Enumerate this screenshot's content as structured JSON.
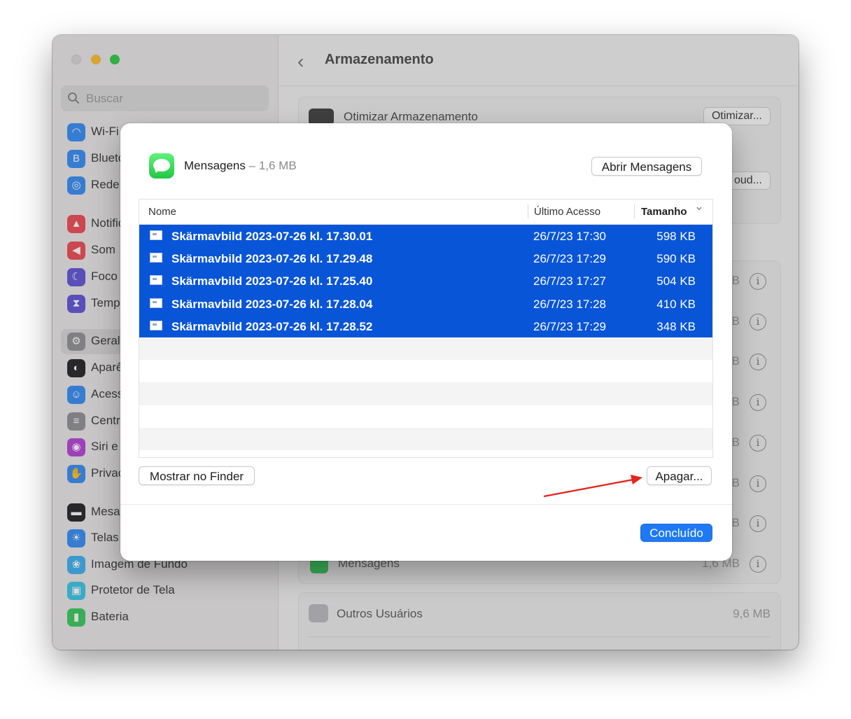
{
  "sidebar": {
    "search_placeholder": "Buscar",
    "items": [
      {
        "label": "Wi-Fi",
        "icon": "wifi-icon",
        "color": "#2f8af6"
      },
      {
        "label": "Bluetooth",
        "icon": "bluetooth-icon",
        "color": "#2f8af6"
      },
      {
        "label": "Rede",
        "icon": "globe-icon",
        "color": "#2f8af6"
      },
      {
        "label": "Notificações",
        "icon": "bell-icon",
        "color": "#f0454d"
      },
      {
        "label": "Som",
        "icon": "speaker-icon",
        "color": "#f0454d"
      },
      {
        "label": "Foco",
        "icon": "moon-icon",
        "color": "#5a4fd6"
      },
      {
        "label": "Tempo de Uso",
        "icon": "hourglass-icon",
        "color": "#5a4fd6"
      },
      {
        "label": "Geral",
        "icon": "gear-icon",
        "color": "#8e8e93"
      },
      {
        "label": "Aparência",
        "icon": "appearance-icon",
        "color": "#1d1d1f"
      },
      {
        "label": "Acessibilidade",
        "icon": "accessibility-icon",
        "color": "#2f8af6"
      },
      {
        "label": "Central de Controle",
        "icon": "control-center-icon",
        "color": "#8e8e93"
      },
      {
        "label": "Siri e Spotlight",
        "icon": "siri-icon",
        "color": "#b43bd6"
      },
      {
        "label": "Privacidade e Segurança",
        "icon": "hand-icon",
        "color": "#2f8af6"
      },
      {
        "label": "Mesa e Dock",
        "icon": "dock-icon",
        "color": "#1d1d1f"
      },
      {
        "label": "Telas",
        "icon": "display-icon",
        "color": "#2f8af6"
      },
      {
        "label": "Imagem de Fundo",
        "icon": "wallpaper-icon",
        "color": "#35aef0"
      },
      {
        "label": "Protetor de Tela",
        "icon": "screensaver-icon",
        "color": "#35c3e8"
      },
      {
        "label": "Bateria",
        "icon": "battery-icon",
        "color": "#34c759"
      }
    ]
  },
  "main": {
    "title": "Armazenamento",
    "optimize_label": "Otimizar Armazenamento",
    "optimize_button": "Otimizar...",
    "icloud_button": "oud...",
    "rows": [
      {
        "size": "B"
      },
      {
        "size": "B"
      },
      {
        "size": "B"
      },
      {
        "size": "B"
      },
      {
        "size": "B"
      },
      {
        "size": "B"
      },
      {
        "size": "B"
      },
      {
        "name": "Mensagens",
        "size": "1,6 MB"
      }
    ],
    "other_users_label": "Outros Usuários",
    "other_users_size": "9,6 MB",
    "info_glyph": "i"
  },
  "dialog": {
    "app_name": "Mensagens",
    "separator": "–",
    "app_size": "1,6 MB",
    "open_button": "Abrir Mensagens",
    "columns": {
      "name": "Nome",
      "last_access": "Último Acesso",
      "size": "Tamanho"
    },
    "files": [
      {
        "name": "Skärmavbild 2023-07-26 kl. 17.30.01",
        "last_access": "26/7/23 17:30",
        "size": "598 KB"
      },
      {
        "name": "Skärmavbild 2023-07-26 kl. 17.29.48",
        "last_access": "26/7/23 17:29",
        "size": "590 KB"
      },
      {
        "name": "Skärmavbild 2023-07-26 kl. 17.25.40",
        "last_access": "26/7/23 17:27",
        "size": "504 KB"
      },
      {
        "name": "Skärmavbild 2023-07-26 kl. 17.28.04",
        "last_access": "26/7/23 17:28",
        "size": "410 KB"
      },
      {
        "name": "Skärmavbild 2023-07-26 kl. 17.28.52",
        "last_access": "26/7/23 17:29",
        "size": "348 KB"
      }
    ],
    "show_in_finder_button": "Mostrar no Finder",
    "delete_button": "Apagar...",
    "done_button": "Concluído",
    "colors": {
      "selection": "#0955d8",
      "accent": "#1f79f5",
      "annotation_arrow": "#e5251d"
    }
  }
}
